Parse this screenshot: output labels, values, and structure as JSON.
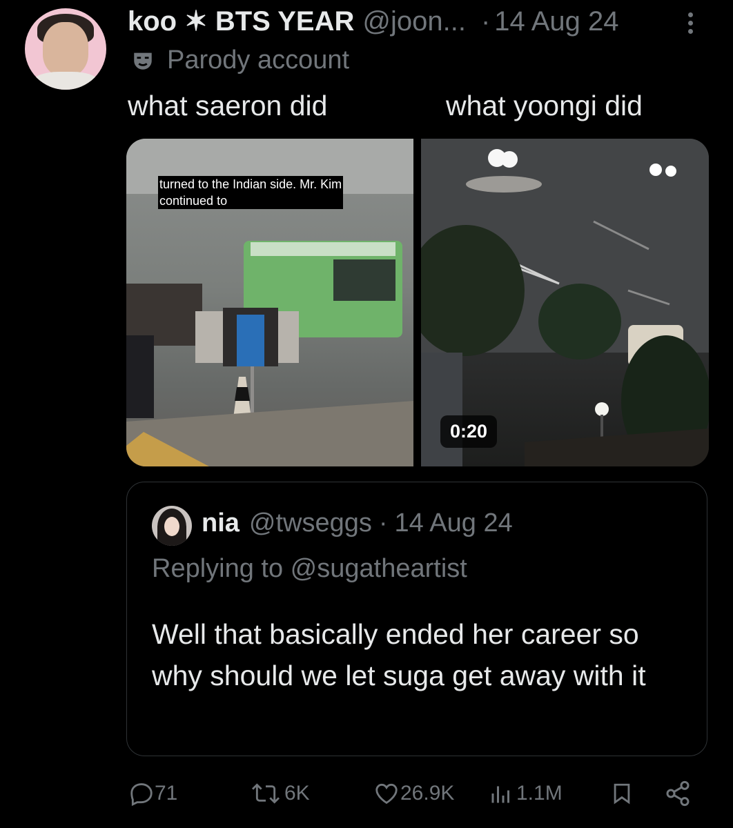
{
  "post": {
    "author_name": "koo ✶ BTS YEAR",
    "handle": "@joon...",
    "separator": "·",
    "date": "14 Aug 24",
    "parody_label": "Parody account",
    "caption_left": "what saeron did",
    "caption_right": "what yoongi did"
  },
  "media": {
    "subtitle_line1": "turned to the Indian side. Mr. Kim",
    "subtitle_line2": "continued to",
    "duration": "0:20"
  },
  "quoted": {
    "name": "nia",
    "handle": "@twseggs",
    "separator": "·",
    "date": "14 Aug 24",
    "replying_to": "Replying to @sugatheartist",
    "text": "Well that basically ended her career so why should we let suga get away with it"
  },
  "actions": {
    "replies": "71",
    "reposts": "6K",
    "likes": "26.9K",
    "views": "1.1M"
  },
  "icons": [
    "more-icon",
    "parody-mask-icon",
    "reply-icon",
    "repost-icon",
    "like-icon",
    "views-icon",
    "bookmark-icon",
    "share-icon"
  ],
  "colors": {
    "background": "#000000",
    "text": "#e7e9ea",
    "muted": "#71767b",
    "border": "#2f3336"
  }
}
